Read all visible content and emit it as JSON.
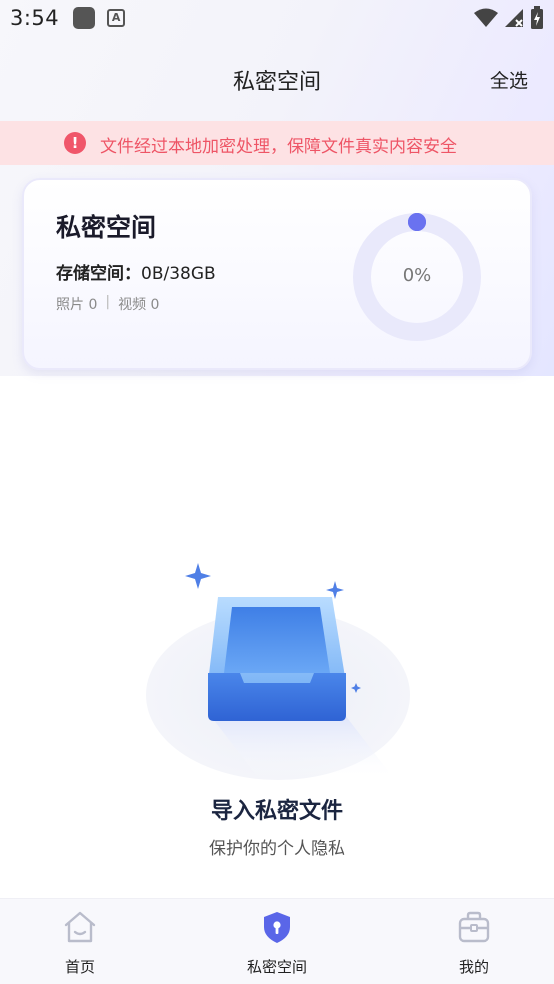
{
  "status_bar": {
    "time": "3:54"
  },
  "header": {
    "title": "私密空间",
    "select_all": "全选"
  },
  "warning": {
    "text": "文件经过本地加密处理，保障文件真实内容安全"
  },
  "card": {
    "title": "私密空间",
    "storage_label": "存储空间：",
    "storage_value": "0B/38GB",
    "photos": "照片 0",
    "separator": "|",
    "videos": "视频 0",
    "percent_text": "0%",
    "usage_fraction": 0
  },
  "empty_state": {
    "title": "导入私密文件",
    "subtitle": "保护你的个人隐私"
  },
  "tabs": [
    {
      "label": "首页",
      "icon": "home-icon"
    },
    {
      "label": "私密空间",
      "icon": "shield-icon"
    },
    {
      "label": "我的",
      "icon": "briefcase-icon"
    }
  ],
  "colors": {
    "accent": "#6a72f0",
    "warning_bg": "#fde2e4",
    "warning_text": "#ee5566"
  }
}
